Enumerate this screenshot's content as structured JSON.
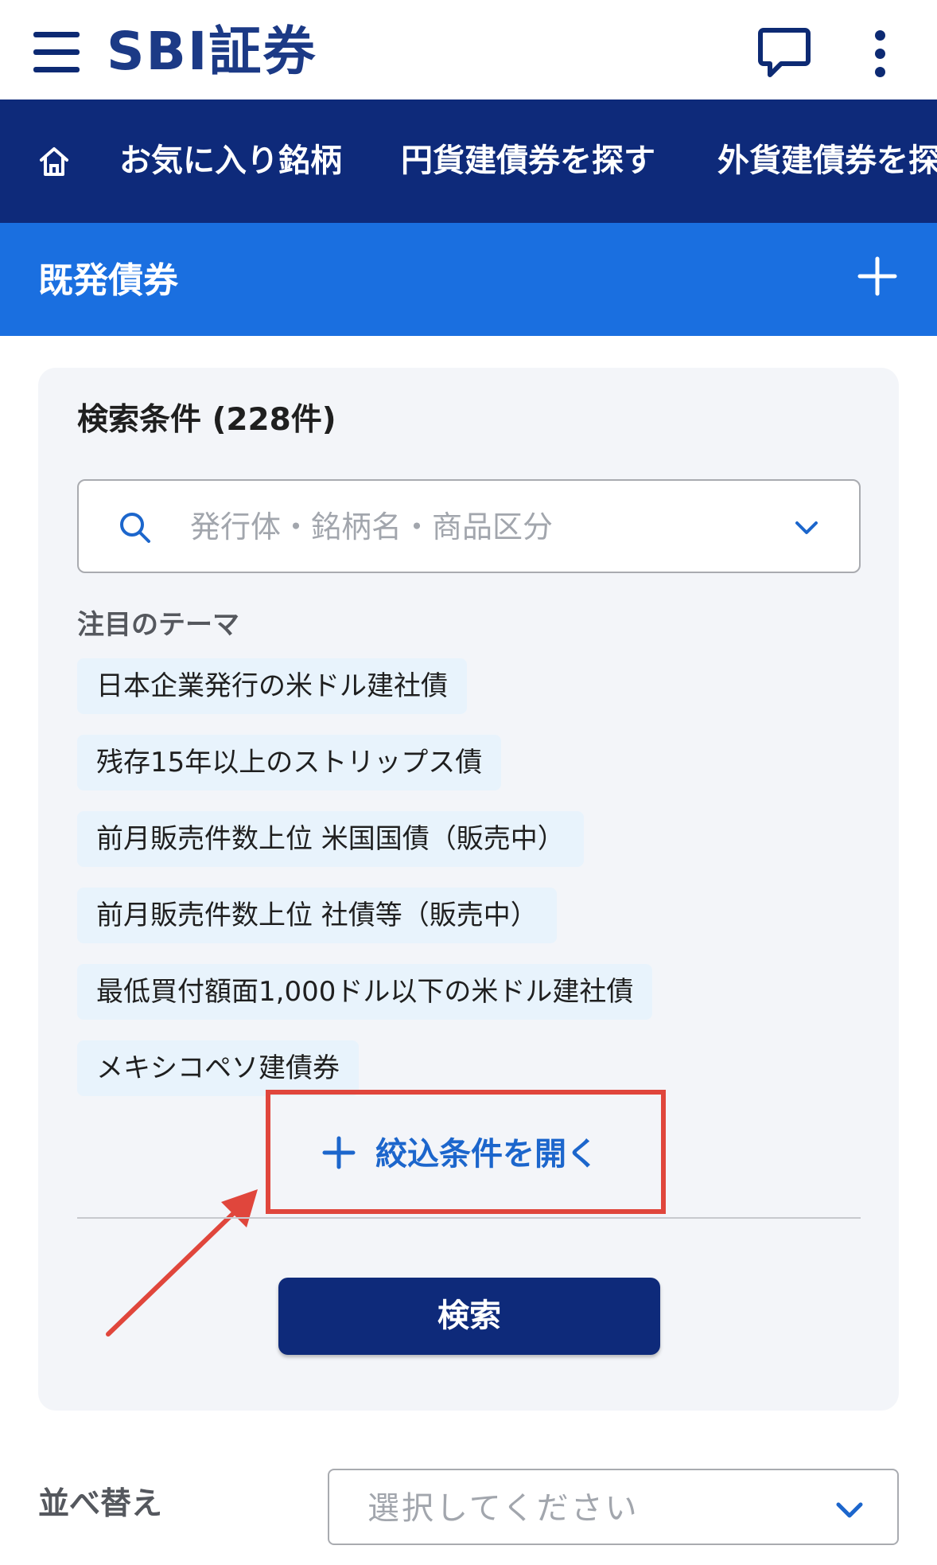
{
  "header": {
    "logo_text": "SBI証券",
    "icons": [
      "menu-icon",
      "chat-icon",
      "more-vertical-icon"
    ]
  },
  "nav": {
    "home_icon": "home-icon",
    "items": [
      "お気に入り銘柄",
      "円貨建債券を探す",
      "外貨建債券を探"
    ]
  },
  "section": {
    "title": "既発債券",
    "expand_icon": "plus-icon"
  },
  "search_panel": {
    "title": "検索条件 (228件)",
    "search_placeholder": "発行体・銘柄名・商品区分",
    "themes_label": "注目のテーマ",
    "themes": [
      "日本企業発行の米ドル建社債",
      "残存15年以上のストリップス債",
      "前月販売件数上位 米国国債（販売中）",
      "前月販売件数上位 社債等（販売中）",
      "最低買付額面1,000ドル以下の米ドル建社債",
      "メキシコペソ建債券"
    ],
    "filter_toggle_label": "絞込条件を開く",
    "search_button_label": "検索"
  },
  "sort": {
    "label": "並べ替え",
    "selected_value": "選択してください"
  },
  "colors": {
    "brand_navy": "#0e2a7a",
    "section_blue": "#1a6fe0",
    "link_blue": "#1c66cc",
    "highlight_red": "#e0463c",
    "chip_bg": "#e8f3fc"
  }
}
